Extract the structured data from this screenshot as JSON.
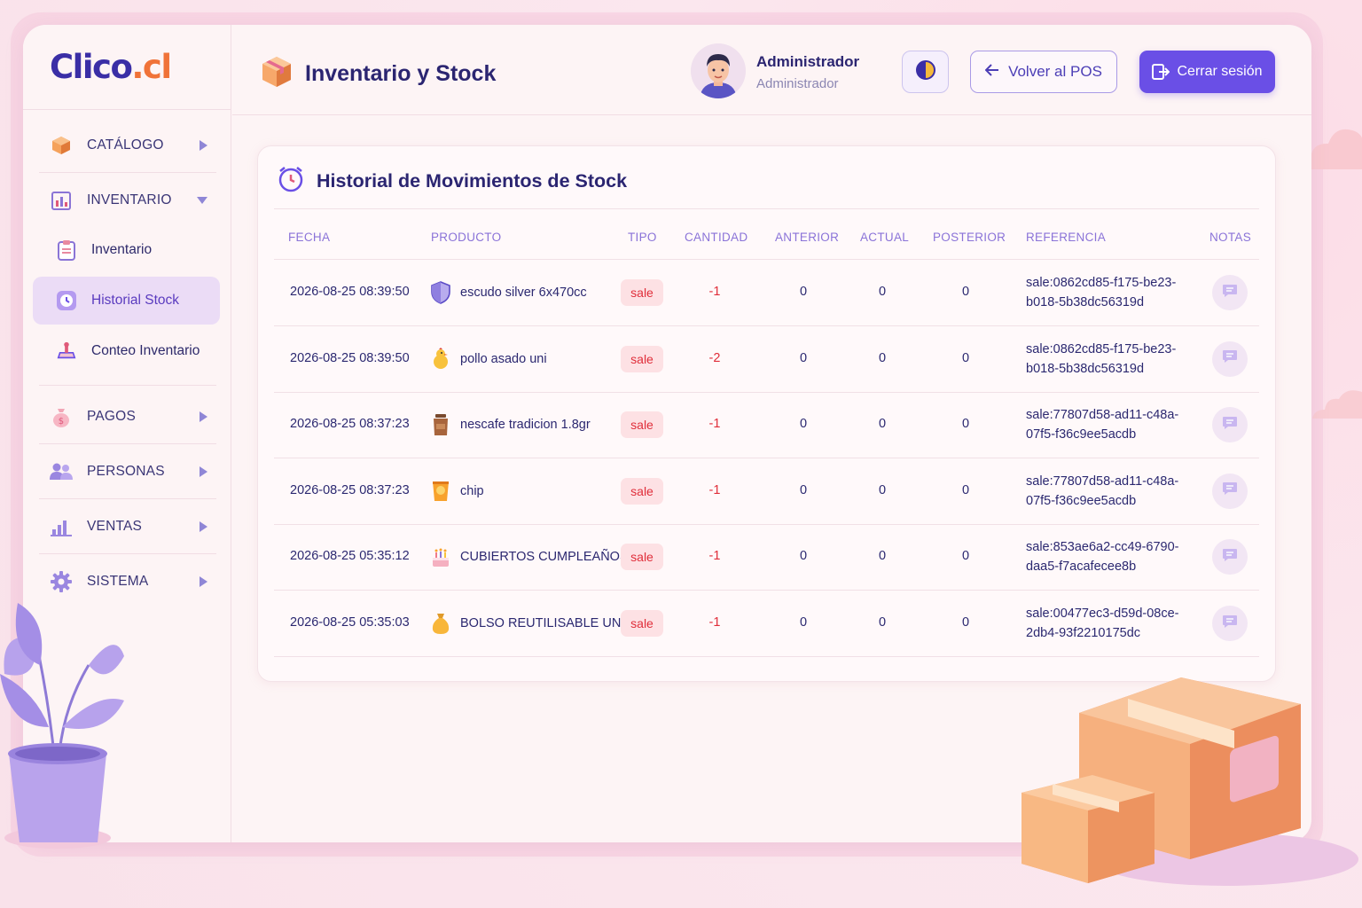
{
  "brand": {
    "logo_main": "Clico",
    "logo_dot": ".cl"
  },
  "sidebar": {
    "catalogo": "CATÁLOGO",
    "inventario": "INVENTARIO",
    "sub": {
      "inventario": "Inventario",
      "historial": "Historial Stock",
      "conteo": "Conteo Inventario"
    },
    "pagos": "PAGOS",
    "personas": "PERSONAS",
    "ventas": "VENTAS",
    "sistema": "SISTEMA"
  },
  "header": {
    "title": "Inventario y Stock",
    "user_name": "Administrador",
    "user_role": "Administrador",
    "back_label": "Volver al POS",
    "logout_label": "Cerrar sesión"
  },
  "card": {
    "title": "Historial de Movimientos de Stock",
    "columns": [
      "FECHA",
      "PRODUCTO",
      "TIPO",
      "CANTIDAD",
      "ANTERIOR",
      "ACTUAL",
      "POSTERIOR",
      "REFERENCIA",
      "NOTAS"
    ],
    "rows": [
      {
        "fecha": "2026-08-25 08:39:50",
        "producto": "escudo silver 6x470cc",
        "icon": "shield-icon",
        "tipo": "sale",
        "cantidad": "-1",
        "anterior": "0",
        "actual": "0",
        "posterior": "0",
        "ref1": "sale:0862cd85-f175-be23-",
        "ref2": "b018-5b38dc56319d"
      },
      {
        "fecha": "2026-08-25 08:39:50",
        "producto": "pollo asado uni",
        "icon": "chicken-icon",
        "tipo": "sale",
        "cantidad": "-2",
        "anterior": "0",
        "actual": "0",
        "posterior": "0",
        "ref1": "sale:0862cd85-f175-be23-",
        "ref2": "b018-5b38dc56319d"
      },
      {
        "fecha": "2026-08-25 08:37:23",
        "producto": "nescafe tradicion 1.8gr",
        "icon": "coffee-jar-icon",
        "tipo": "sale",
        "cantidad": "-1",
        "anterior": "0",
        "actual": "0",
        "posterior": "0",
        "ref1": "sale:77807d58-ad11-c48a-",
        "ref2": "07f5-f36c9ee5acdb"
      },
      {
        "fecha": "2026-08-25 08:37:23",
        "producto": "chip",
        "icon": "chip-bag-icon",
        "tipo": "sale",
        "cantidad": "-1",
        "anterior": "0",
        "actual": "0",
        "posterior": "0",
        "ref1": "sale:77807d58-ad11-c48a-",
        "ref2": "07f5-f36c9ee5acdb"
      },
      {
        "fecha": "2026-08-25 05:35:12",
        "producto": "CUBIERTOS CUMPLEAÑOS",
        "icon": "cake-icon",
        "tipo": "sale",
        "cantidad": "-1",
        "anterior": "0",
        "actual": "0",
        "posterior": "0",
        "ref1": "sale:853ae6a2-cc49-6790-",
        "ref2": "daa5-f7acafecee8b"
      },
      {
        "fecha": "2026-08-25 05:35:03",
        "producto": "BOLSO REUTILISABLE UNI.",
        "icon": "bag-icon",
        "tipo": "sale",
        "cantidad": "-1",
        "anterior": "0",
        "actual": "0",
        "posterior": "0",
        "ref1": "sale:00477ec3-d59d-08ce-",
        "ref2": "2db4-93f2210175dc"
      }
    ]
  },
  "colors": {
    "accent": "#6a4fe6",
    "brand": "#3a2ea6",
    "brand_dot": "#f07238",
    "negative": "#e02e3a",
    "sale_badge_bg": "#fde1e4"
  }
}
